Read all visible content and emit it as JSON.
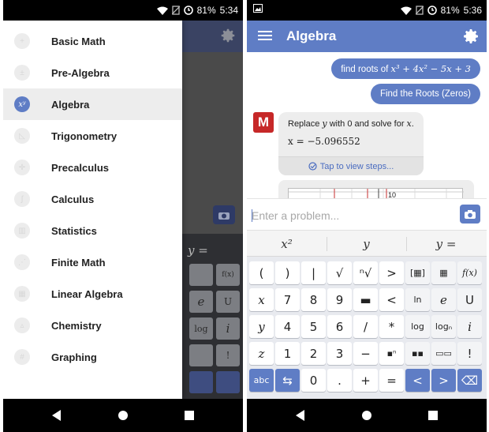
{
  "left_phone": {
    "status": {
      "battery": "81%",
      "time": "5:34"
    },
    "drawer_items": [
      {
        "label": "Basic Math",
        "icon": "plus-circle-icon",
        "active": false
      },
      {
        "label": "Pre-Algebra",
        "icon": "plus-minus-icon",
        "active": false
      },
      {
        "label": "Algebra",
        "icon": "x-power-y-icon",
        "active": true,
        "glyph": "xʸ"
      },
      {
        "label": "Trigonometry",
        "icon": "triangle-icon",
        "active": false
      },
      {
        "label": "Precalculus",
        "icon": "axes-icon",
        "active": false
      },
      {
        "label": "Calculus",
        "icon": "integral-icon",
        "active": false
      },
      {
        "label": "Statistics",
        "icon": "bar-chart-icon",
        "active": false
      },
      {
        "label": "Finite Math",
        "icon": "network-icon",
        "active": false
      },
      {
        "label": "Linear Algebra",
        "icon": "matrix-icon",
        "active": false
      },
      {
        "label": "Chemistry",
        "icon": "flask-icon",
        "active": false
      },
      {
        "label": "Graphing",
        "icon": "grid-icon",
        "active": false
      }
    ],
    "background_keys": [
      "f(x)",
      "e",
      "U",
      "log",
      "i",
      "!",
      "y ="
    ]
  },
  "right_phone": {
    "status": {
      "battery": "81%",
      "time": "5:36"
    },
    "app_title": "Algebra",
    "messages": {
      "user_query_prefix": "find roots of",
      "user_query_math": "x³ + 4x² − 5x + 3",
      "user_action": "Find the Roots (Zeros)",
      "bot_line1_a": "Replace",
      "bot_line1_var": "y",
      "bot_line1_b": "with 0 and solve for",
      "bot_line1_var2": "x",
      "bot_answer": "x = −5.096552",
      "steps_link": "Tap to view steps...",
      "graph_label": "10"
    },
    "input": {
      "placeholder": "Enter a problem..."
    },
    "suggestions": [
      "x²",
      "y",
      "y ="
    ],
    "keyboard_rows": [
      [
        "(",
        ")",
        "|",
        "√",
        "ⁿ√",
        ">",
        "[▦]",
        "▦",
        "f(x)"
      ],
      [
        "x",
        "7",
        "8",
        "9",
        "▬",
        "<",
        "ln",
        "e",
        "U"
      ],
      [
        "y",
        "4",
        "5",
        "6",
        "/",
        "*",
        "log",
        "logₙ",
        "i"
      ],
      [
        "z",
        "1",
        "2",
        "3",
        "−",
        "▪ⁿ",
        "▪▪",
        "▭▭",
        "!"
      ],
      [
        "abc",
        "⇆",
        "0",
        ".",
        "+",
        "=",
        "<",
        ">",
        "⌫"
      ]
    ],
    "accent": "#5f7dc5"
  }
}
